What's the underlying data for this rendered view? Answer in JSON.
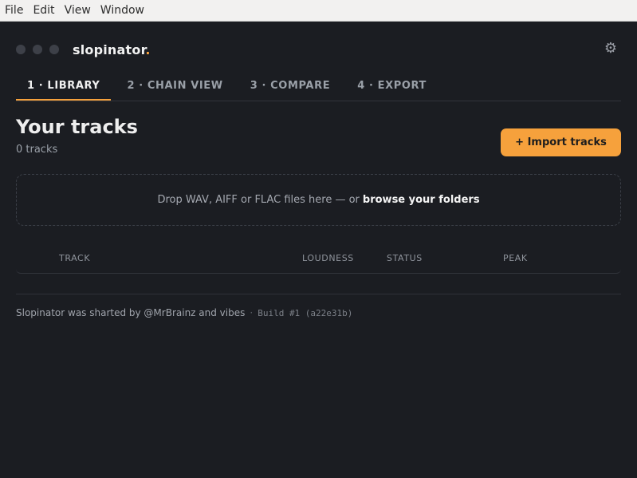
{
  "menubar": {
    "items": [
      "File",
      "Edit",
      "View",
      "Window"
    ]
  },
  "header": {
    "app_name": "slopinator",
    "app_name_suffix": ".",
    "settings_icon": "gear-icon"
  },
  "tabs": [
    {
      "label": "1 · LIBRARY",
      "active": true
    },
    {
      "label": "2 · CHAIN VIEW",
      "active": false
    },
    {
      "label": "3 · COMPARE",
      "active": false
    },
    {
      "label": "4 · EXPORT",
      "active": false
    }
  ],
  "library": {
    "title": "Your tracks",
    "count_text": "0 tracks",
    "import_label": "+ Import tracks",
    "dropzone_text": "Drop WAV, AIFF or FLAC files here — or",
    "dropzone_link": "browse your folders"
  },
  "table": {
    "columns": [
      "TRACK",
      "LOUDNESS",
      "STATUS",
      "PEAK"
    ]
  },
  "footer": {
    "credit": "Slopinator was sharted by @MrBrainz and vibes",
    "separator": "·",
    "build": "Build #1 (a22e31b)"
  },
  "colors": {
    "accent": "#f6a13c",
    "background": "#1b1d22"
  }
}
